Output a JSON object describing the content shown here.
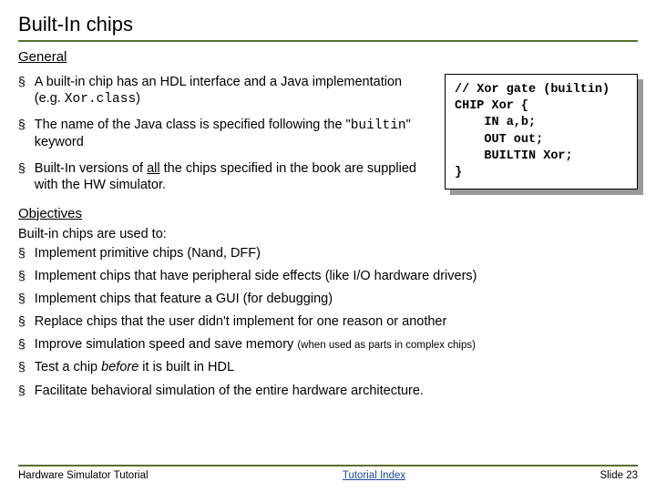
{
  "title": "Built-In chips",
  "sections": {
    "general_heading": "General",
    "general_bullets": [
      "A built-in chip has an HDL interface and a Java implementation (e.g. Xor.class)",
      "The name of the Java class is specified following the \"builtin\" keyword",
      "Built-In versions of all the chips specified in the book are supplied with the HW simulator."
    ],
    "objectives_heading": "Objectives",
    "objectives_intro": "Built-in chips are used to:",
    "objectives_bullets": [
      "Implement primitive chips (Nand, DFF)",
      "Implement chips that have peripheral side effects (like I/O hardware drivers)",
      "Implement chips that feature a GUI (for debugging)",
      "Replace chips that the user didn't implement for one reason or another",
      "Improve simulation speed and save memory (when used as parts in complex chips)",
      "Test a chip before it is built in HDL",
      "Facilitate behavioral simulation of the entire hardware architecture."
    ]
  },
  "code_block": "// Xor gate (builtin)\nCHIP Xor {\n    IN a,b;\n    OUT out;\n    BUILTIN Xor;\n}",
  "footer": {
    "left": "Hardware Simulator Tutorial",
    "center": "Tutorial Index",
    "right": "Slide 23"
  }
}
